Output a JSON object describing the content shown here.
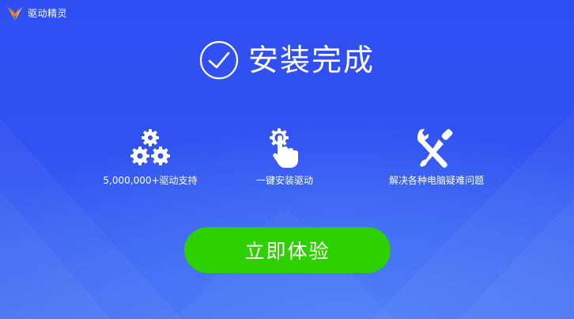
{
  "window": {
    "app_title": "驱动精灵"
  },
  "hero": {
    "title": "安装完成"
  },
  "features": [
    {
      "icon": "gears-icon",
      "label": "5,000,000+驱动支持"
    },
    {
      "icon": "pointer-hand-icon",
      "label": "一键安装驱动"
    },
    {
      "icon": "wrench-screwdriver-icon",
      "label": "解决各种电脑疑难问题"
    }
  ],
  "cta": {
    "label": "立即体验"
  },
  "colors": {
    "background_top": "#2f4ff3",
    "background_bottom": "#3f6cf3",
    "cta_green": "#2fd000",
    "logo_orange": "#f39a1e",
    "text": "#ffffff"
  }
}
